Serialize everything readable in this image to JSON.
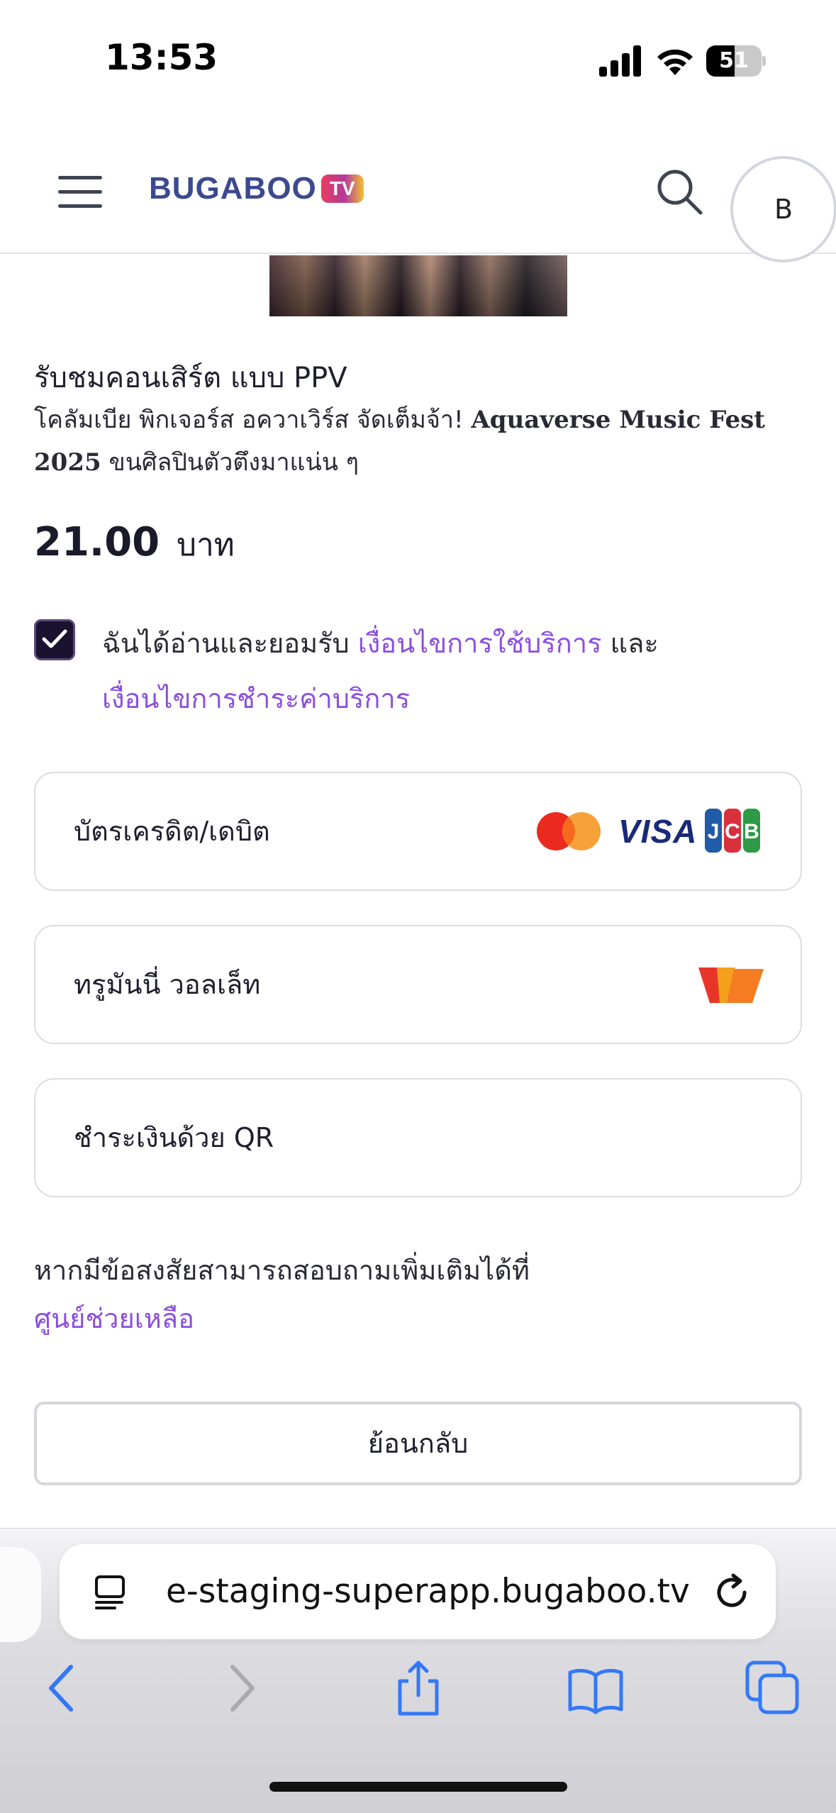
{
  "status_bar": {
    "time": "13:53",
    "battery_level": "51"
  },
  "header": {
    "logo_text": "BUGABOO",
    "logo_badge": "TV",
    "avatar_initial": "B"
  },
  "event": {
    "title": "รับชมคอนเสิร์ต แบบ PPV",
    "desc_prefix": "โคลัมเบีย พิกเจอร์ส อควาเวิร์ส จัดเต็มจ้า! ",
    "desc_bold": "Aquaverse Music Fest 2025",
    "desc_suffix": " ขนศิลปินตัวตึงมาแน่น ๆ"
  },
  "price": {
    "amount": "21.00",
    "currency": "บาท"
  },
  "terms": {
    "checked": true,
    "text_prefix": "ฉันได้อ่านและยอมรับ ",
    "link_terms_of_use": "เงื่อนไขการใช้บริการ",
    "text_and": " และ",
    "link_payment_terms": "เงื่อนไขการชำระค่าบริการ"
  },
  "payment_options": [
    {
      "label": "บัตรเครดิต/เดบิต",
      "icons": [
        "mastercard-icon",
        "visa-icon",
        "jcb-icon"
      ]
    },
    {
      "label": "ทรูมันนี่ วอลเล็ท",
      "icons": [
        "truemoney-icon"
      ]
    },
    {
      "label": "ชำระเงินด้วย QR",
      "icons": []
    }
  ],
  "card_brands": {
    "visa": "VISA",
    "jcb": "JCB"
  },
  "help": {
    "text": "หากมีข้อสงสัยสามารถสอบถามเพิ่มเติมได้ที่",
    "link": "ศูนย์ช่วยเหลือ"
  },
  "back_button": "ย้อนกลับ",
  "browser": {
    "url": "e-staging-superapp.bugaboo.tv"
  },
  "colors": {
    "accent_link": "#8b4ee0",
    "checkbox": "#1b1230",
    "safari_blue": "#3478f6"
  }
}
